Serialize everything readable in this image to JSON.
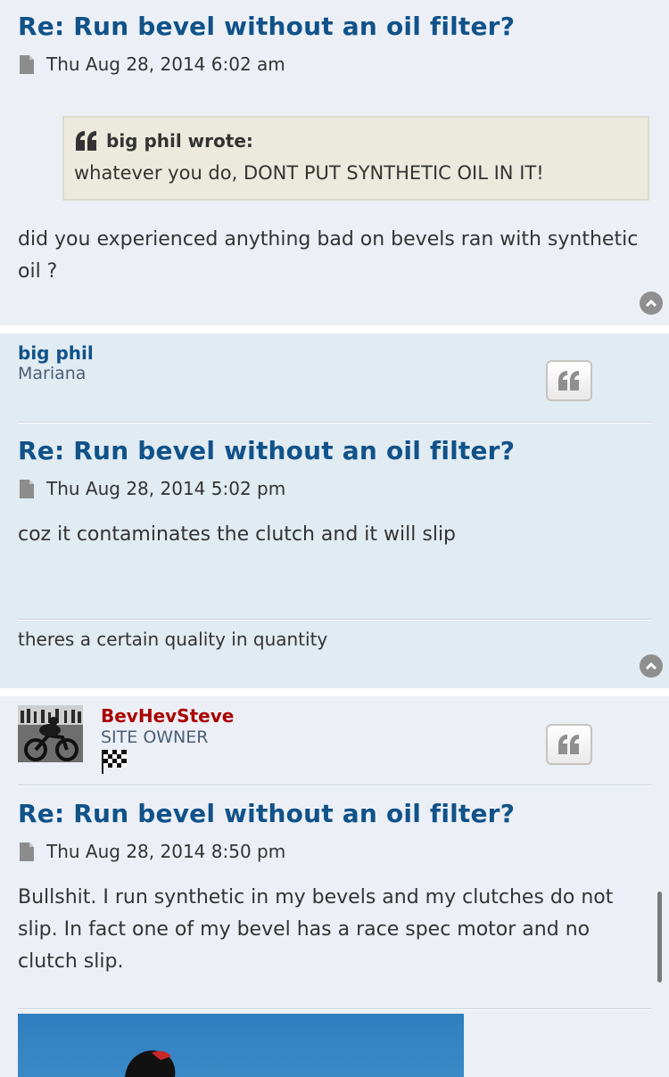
{
  "posts": [
    {
      "title": "Re: Run bevel without an oil filter?",
      "date": "Thu Aug 28, 2014 6:02 am",
      "quote": {
        "author": "big phil wrote:",
        "text": "whatever you do, DONT PUT SYNTHETIC OIL IN IT!"
      },
      "body": "did you experienced anything bad on bevels ran with synthetic oil ?"
    },
    {
      "author": "big phil",
      "location": "Mariana",
      "title": "Re: Run bevel without an oil filter?",
      "date": "Thu Aug 28, 2014 5:02 pm",
      "body": "coz it contaminates the clutch and it will slip",
      "signature": "theres a certain quality in quantity"
    },
    {
      "author": "BevHevSteve",
      "rank": "SITE OWNER",
      "title": "Re: Run bevel without an oil filter?",
      "date": "Thu Aug 28, 2014 8:50 pm",
      "body": "Bullshit. I run synthetic in my bevels and my clutches do not slip. In fact one of my bevel has a race spec motor and no clutch slip."
    }
  ],
  "colors": {
    "title": "#105289",
    "author_normal": "#105289",
    "author_admin": "#aa0000",
    "post_bg_light": "#ecf0f6",
    "post_bg_blue": "#e1ebf2",
    "quote_bg": "#ebeadd"
  },
  "icons": {
    "file": "file-icon",
    "quote": "quote-icon",
    "top": "chevron-up-circle-icon",
    "rank_image": "checkered-flag-icon",
    "avatar": "avatar-image"
  }
}
